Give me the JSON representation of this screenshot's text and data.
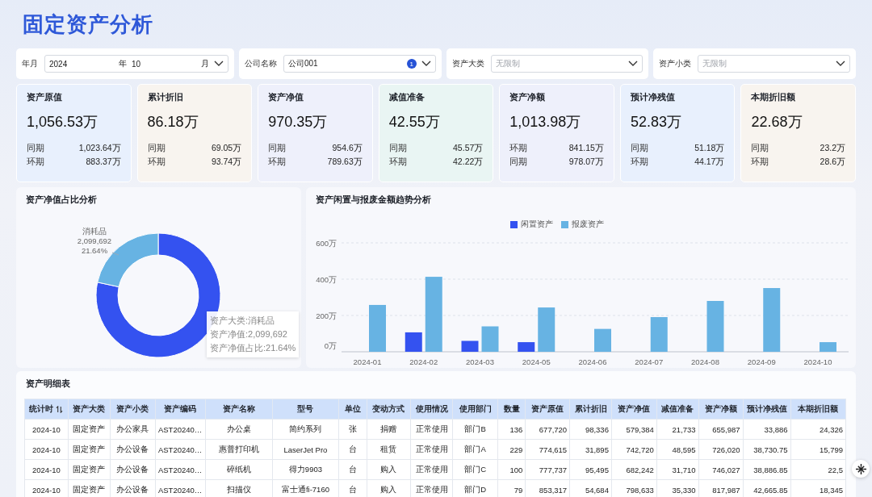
{
  "title": "固定资产分析",
  "filters": [
    {
      "kind": "month",
      "label": "年月",
      "year": "2024",
      "year_unit": "年",
      "month": "10",
      "month_unit": "月"
    },
    {
      "kind": "select",
      "label": "公司名称",
      "value": "公司001",
      "badge": "1"
    },
    {
      "kind": "select",
      "label": "资产大类",
      "placeholder": "无限制"
    },
    {
      "kind": "select",
      "label": "资产小类",
      "placeholder": "无限制"
    }
  ],
  "kpis": [
    {
      "label": "资产原值",
      "value": "1,056.53万",
      "color": "#e8f0fd",
      "compare": [
        {
          "label": "同期",
          "value": "1,023.64万"
        },
        {
          "label": "环期",
          "value": "883.37万"
        }
      ]
    },
    {
      "label": "累计折旧",
      "value": "86.18万",
      "color": "#f8f4ef",
      "compare": [
        {
          "label": "同期",
          "value": "69.05万"
        },
        {
          "label": "环期",
          "value": "93.74万"
        }
      ]
    },
    {
      "label": "资产净值",
      "value": "970.35万",
      "color": "#eef0fb",
      "compare": [
        {
          "label": "同期",
          "value": "954.6万"
        },
        {
          "label": "环期",
          "value": "789.63万"
        }
      ]
    },
    {
      "label": "减值准备",
      "value": "42.55万",
      "color": "#e9f5f3",
      "compare": [
        {
          "label": "同期",
          "value": "45.57万"
        },
        {
          "label": "环期",
          "value": "42.22万"
        }
      ]
    },
    {
      "label": "资产净额",
      "value": "1,013.98万",
      "color": "#eef0fb",
      "compare": [
        {
          "label": "环期",
          "value": "841.15万"
        },
        {
          "label": "同期",
          "value": "978.07万"
        }
      ]
    },
    {
      "label": "预计净残值",
      "value": "52.83万",
      "color": "#e8f0fd",
      "compare": [
        {
          "label": "同期",
          "value": "51.18万"
        },
        {
          "label": "环期",
          "value": "44.17万"
        }
      ]
    },
    {
      "label": "本期折旧额",
      "value": "22.68万",
      "color": "#f8f4ef",
      "compare": [
        {
          "label": "同期",
          "value": "23.2万"
        },
        {
          "label": "环期",
          "value": "28.6万"
        }
      ]
    }
  ],
  "share_panel": {
    "title": "资产净值占比分析",
    "donut": {
      "label": [
        "消耗品",
        "2,099,692",
        "21.64%"
      ]
    },
    "tooltip": [
      "资产大类:消耗品",
      "资产净值:2,099,692",
      "资产净值占比:21.64%"
    ]
  },
  "trend_panel": {
    "title": "资产闲置与报废金额趋势分析",
    "chart_data": {
      "type": "bar",
      "categories": [
        "2024-01",
        "2024-02",
        "2024-03",
        "2024-05",
        "2024-06",
        "2024-07",
        "2024-08",
        "2024-09",
        "2024-10"
      ],
      "series": [
        {
          "name": "闲置资产",
          "color": "#3452f0",
          "values": [
            null,
            107,
            60,
            53,
            null,
            null,
            null,
            null,
            null
          ]
        },
        {
          "name": "报废资产",
          "color": "#67b3e3",
          "values": [
            258,
            413,
            140,
            244,
            126,
            191,
            280,
            351,
            53
          ]
        }
      ],
      "ylim": [
        0,
        600
      ],
      "yticks": [
        {
          "value": 0,
          "label": "0万"
        },
        {
          "value": 200,
          "label": "200万"
        },
        {
          "value": 400,
          "label": "400万"
        },
        {
          "value": 600,
          "label": "600万"
        }
      ]
    }
  },
  "table": {
    "title": "资产明细表",
    "columns": [
      "统计时",
      "资产大类",
      "资产小类",
      "资产编码",
      "资产名称",
      "型号",
      "单位",
      "变动方式",
      "使用情况",
      "使用部门",
      "数量",
      "资产原值",
      "累计折旧",
      "资产净值",
      "减值准备",
      "资产净额",
      "预计净残值",
      "本期折旧额"
    ],
    "rows": [
      [
        "2024-10",
        "固定资产",
        "办公家具",
        "AST20240…",
        "办公桌",
        "简约系列",
        "张",
        "捐赠",
        "正常使用",
        "部门B",
        "136",
        "677,720",
        "98,336",
        "579,384",
        "21,733",
        "655,987",
        "33,886",
        "24,326"
      ],
      [
        "2024-10",
        "固定资产",
        "办公设备",
        "AST20240…",
        "惠普打印机",
        "LaserJet Pro",
        "台",
        "租赁",
        "正常使用",
        "部门A",
        "229",
        "774,615",
        "31,895",
        "742,720",
        "48,595",
        "726,020",
        "38,730.75",
        "15,799"
      ],
      [
        "2024-10",
        "固定资产",
        "办公设备",
        "AST20240…",
        "碎纸机",
        "得力9903",
        "台",
        "购入",
        "正常使用",
        "部门C",
        "100",
        "777,737",
        "95,495",
        "682,242",
        "31,710",
        "746,027",
        "38,886.85",
        "22,5"
      ],
      [
        "2024-10",
        "固定资产",
        "办公设备",
        "AST20240…",
        "扫描仪",
        "富士通fi-7160",
        "台",
        "购入",
        "正常使用",
        "部门D",
        "79",
        "853,317",
        "54,684",
        "798,633",
        "35,330",
        "817,987",
        "42,665.85",
        "18,345"
      ]
    ]
  }
}
